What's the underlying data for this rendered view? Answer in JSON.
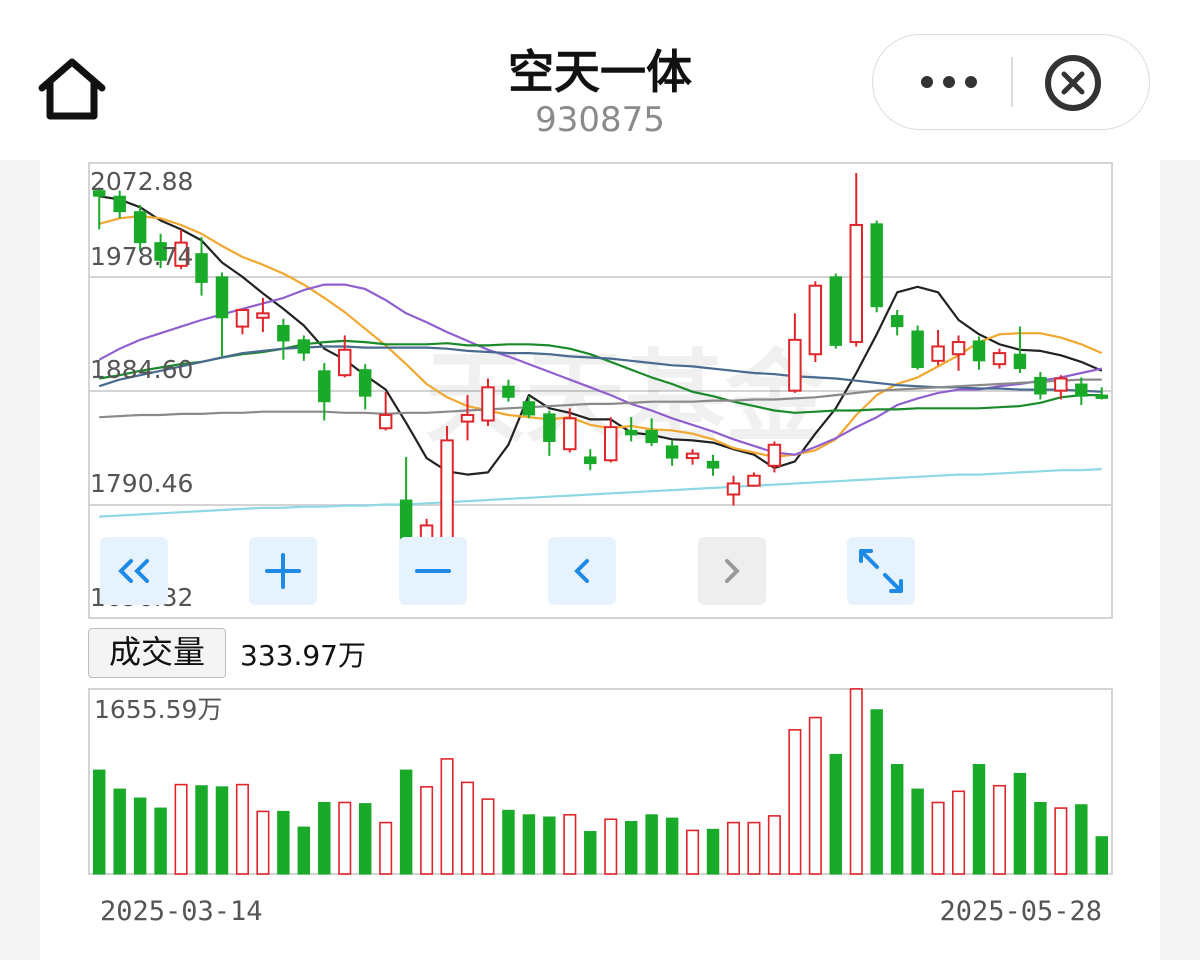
{
  "header": {
    "title": "空天一体",
    "code": "930875"
  },
  "price_axis": {
    "labels": [
      "2072.88",
      "1978.74",
      "1884.60",
      "1790.46",
      "1696.32"
    ]
  },
  "volume": {
    "label": "成交量",
    "current": "333.97万",
    "max_label": "1655.59万"
  },
  "dates": {
    "start": "2025-03-14",
    "end": "2025-05-28"
  },
  "watermark": "天天基金",
  "controls": [
    "first-page",
    "zoom-in",
    "zoom-out",
    "previous",
    "next",
    "fullscreen"
  ],
  "colors": {
    "up": "#e0252b",
    "down": "#1aaa2a",
    "ma5": "#222222",
    "ma10": "#f0a830",
    "ma20": "#9060d0",
    "ma30": "#1a8a2a",
    "ma60": "#4a6a90",
    "ma120": "#8a8a8a",
    "ma250": "#8ed8e6",
    "button_bg": "#e6f2fd",
    "button_icon": "#1e8ae8"
  },
  "chart_data": {
    "type": "candlestick",
    "x_range": [
      "2025-03-14",
      "2025-05-28"
    ],
    "ylim": [
      1696.32,
      2072.88
    ],
    "volume_max": 1655.59,
    "volume_unit": "万",
    "candles": [
      {
        "o": 2065,
        "h": 2068,
        "l": 2030,
        "c": 2060,
        "up": false,
        "vol": 930
      },
      {
        "o": 2060,
        "h": 2065,
        "l": 2040,
        "c": 2046,
        "up": false,
        "vol": 760
      },
      {
        "o": 2046,
        "h": 2052,
        "l": 2010,
        "c": 2018,
        "up": false,
        "vol": 680
      },
      {
        "o": 2018,
        "h": 2026,
        "l": 1995,
        "c": 2002,
        "up": false,
        "vol": 590
      },
      {
        "o": 1997,
        "h": 2030,
        "l": 1994,
        "c": 2018,
        "up": true,
        "vol": 800
      },
      {
        "o": 2008,
        "h": 2023,
        "l": 1970,
        "c": 1982,
        "up": false,
        "vol": 790
      },
      {
        "o": 1987,
        "h": 1991,
        "l": 1915,
        "c": 1950,
        "up": false,
        "vol": 780
      },
      {
        "o": 1942,
        "h": 1957,
        "l": 1935,
        "c": 1957,
        "up": true,
        "vol": 800
      },
      {
        "o": 1950,
        "h": 1968,
        "l": 1937,
        "c": 1954,
        "up": true,
        "vol": 560
      },
      {
        "o": 1943,
        "h": 1949,
        "l": 1912,
        "c": 1929,
        "up": false,
        "vol": 560
      },
      {
        "o": 1930,
        "h": 1934,
        "l": 1911,
        "c": 1918,
        "up": false,
        "vol": 420
      },
      {
        "o": 1902,
        "h": 1909,
        "l": 1857,
        "c": 1874,
        "up": false,
        "vol": 640
      },
      {
        "o": 1898,
        "h": 1934,
        "l": 1896,
        "c": 1921,
        "up": true,
        "vol": 640
      },
      {
        "o": 1903,
        "h": 1908,
        "l": 1867,
        "c": 1879,
        "up": false,
        "vol": 630
      },
      {
        "o": 1850,
        "h": 1883,
        "l": 1848,
        "c": 1862,
        "up": true,
        "vol": 460
      },
      {
        "o": 1785,
        "h": 1824,
        "l": 1706,
        "c": 1720,
        "up": false,
        "vol": 930
      },
      {
        "o": 1733,
        "h": 1768,
        "l": 1731,
        "c": 1762,
        "up": true,
        "vol": 780
      },
      {
        "o": 1737,
        "h": 1852,
        "l": 1736,
        "c": 1839,
        "up": true,
        "vol": 1030
      },
      {
        "o": 1856,
        "h": 1880,
        "l": 1839,
        "c": 1862,
        "up": true,
        "vol": 820
      },
      {
        "o": 1857,
        "h": 1895,
        "l": 1852,
        "c": 1887,
        "up": true,
        "vol": 670
      },
      {
        "o": 1888,
        "h": 1894,
        "l": 1874,
        "c": 1878,
        "up": false,
        "vol": 570
      },
      {
        "o": 1874,
        "h": 1879,
        "l": 1859,
        "c": 1862,
        "up": false,
        "vol": 530
      },
      {
        "o": 1863,
        "h": 1866,
        "l": 1825,
        "c": 1838,
        "up": false,
        "vol": 510
      },
      {
        "o": 1831,
        "h": 1868,
        "l": 1828,
        "c": 1859,
        "up": true,
        "vol": 530
      },
      {
        "o": 1824,
        "h": 1831,
        "l": 1812,
        "c": 1818,
        "up": false,
        "vol": 380
      },
      {
        "o": 1821,
        "h": 1860,
        "l": 1819,
        "c": 1851,
        "up": true,
        "vol": 490
      },
      {
        "o": 1848,
        "h": 1860,
        "l": 1838,
        "c": 1844,
        "up": false,
        "vol": 470
      },
      {
        "o": 1848,
        "h": 1859,
        "l": 1834,
        "c": 1837,
        "up": false,
        "vol": 530
      },
      {
        "o": 1834,
        "h": 1839,
        "l": 1816,
        "c": 1823,
        "up": false,
        "vol": 500
      },
      {
        "o": 1823,
        "h": 1831,
        "l": 1817,
        "c": 1827,
        "up": true,
        "vol": 390
      },
      {
        "o": 1820,
        "h": 1826,
        "l": 1807,
        "c": 1814,
        "up": false,
        "vol": 400
      },
      {
        "o": 1790,
        "h": 1807,
        "l": 1780,
        "c": 1800,
        "up": true,
        "vol": 460
      },
      {
        "o": 1798,
        "h": 1810,
        "l": 1797,
        "c": 1807,
        "up": true,
        "vol": 460
      },
      {
        "o": 1816,
        "h": 1838,
        "l": 1810,
        "c": 1835,
        "up": true,
        "vol": 520
      },
      {
        "o": 1884,
        "h": 1954,
        "l": 1882,
        "c": 1930,
        "up": true,
        "vol": 1290
      },
      {
        "o": 1917,
        "h": 1983,
        "l": 1910,
        "c": 1979,
        "up": true,
        "vol": 1400
      },
      {
        "o": 1925,
        "h": 1990,
        "l": 1922,
        "c": 1987,
        "up": false,
        "vol": 1070
      },
      {
        "o": 1928,
        "h": 2081,
        "l": 1924,
        "c": 2034,
        "up": true,
        "vol": 1656
      },
      {
        "o": 2035,
        "h": 2038,
        "l": 1955,
        "c": 1960,
        "up": false,
        "vol": 1470
      },
      {
        "o": 1952,
        "h": 1957,
        "l": 1934,
        "c": 1942,
        "up": false,
        "vol": 980
      },
      {
        "o": 1938,
        "h": 1943,
        "l": 1903,
        "c": 1905,
        "up": false,
        "vol": 760
      },
      {
        "o": 1911,
        "h": 1939,
        "l": 1907,
        "c": 1924,
        "up": true,
        "vol": 640
      },
      {
        "o": 1917,
        "h": 1934,
        "l": 1902,
        "c": 1928,
        "up": true,
        "vol": 740
      },
      {
        "o": 1929,
        "h": 1933,
        "l": 1903,
        "c": 1911,
        "up": false,
        "vol": 980
      },
      {
        "o": 1908,
        "h": 1922,
        "l": 1904,
        "c": 1918,
        "up": true,
        "vol": 790
      },
      {
        "o": 1917,
        "h": 1942,
        "l": 1900,
        "c": 1904,
        "up": false,
        "vol": 900
      },
      {
        "o": 1896,
        "h": 1901,
        "l": 1876,
        "c": 1881,
        "up": false,
        "vol": 640
      },
      {
        "o": 1884,
        "h": 1898,
        "l": 1876,
        "c": 1895,
        "up": true,
        "vol": 590
      },
      {
        "o": 1890,
        "h": 1896,
        "l": 1871,
        "c": 1879,
        "up": false,
        "vol": 620
      },
      {
        "o": 1880,
        "h": 1887,
        "l": 1876,
        "c": 1877,
        "up": false,
        "vol": 334
      }
    ],
    "moving_averages": [
      {
        "name": "MA5",
        "color": "#222222",
        "values": [
          2060,
          2057,
          2050,
          2038,
          2030,
          2020,
          2000,
          1987,
          1972,
          1958,
          1943,
          1922,
          1912,
          1898,
          1885,
          1855,
          1823,
          1811,
          1808,
          1810,
          1835,
          1880,
          1868,
          1864,
          1858,
          1858,
          1846,
          1844,
          1840,
          1839,
          1837,
          1831,
          1826,
          1814,
          1820,
          1845,
          1868,
          1900,
          1935,
          1973,
          1978,
          1973,
          1948,
          1935,
          1926,
          1921,
          1920,
          1916,
          1910,
          1902
        ]
      },
      {
        "name": "MA10",
        "color": "#f0a830",
        "values": [
          2035,
          2040,
          2042,
          2040,
          2034,
          2026,
          2015,
          2005,
          1998,
          1990,
          1980,
          1968,
          1955,
          1940,
          1925,
          1908,
          1890,
          1878,
          1870,
          1866,
          1862,
          1860,
          1858,
          1860,
          1853,
          1850,
          1852,
          1849,
          1848,
          1845,
          1840,
          1832,
          1828,
          1824,
          1826,
          1830,
          1840,
          1862,
          1880,
          1890,
          1896,
          1906,
          1916,
          1928,
          1935,
          1936,
          1936,
          1932,
          1926,
          1918
        ]
      },
      {
        "name": "MA20",
        "color": "#9060d0",
        "values": [
          1912,
          1922,
          1930,
          1936,
          1942,
          1948,
          1953,
          1958,
          1963,
          1968,
          1975,
          1980,
          1980,
          1976,
          1966,
          1954,
          1946,
          1937,
          1929,
          1921,
          1915,
          1908,
          1901,
          1894,
          1887,
          1880,
          1872,
          1866,
          1859,
          1853,
          1847,
          1840,
          1834,
          1828,
          1826,
          1833,
          1841,
          1851,
          1860,
          1871,
          1877,
          1882,
          1885,
          1885,
          1888,
          1890,
          1893,
          1896,
          1900,
          1904
        ]
      },
      {
        "name": "MA30",
        "color": "#1a8a2a",
        "values": [
          1895,
          1898,
          1902,
          1905,
          1908,
          1910,
          1914,
          1917,
          1919,
          1922,
          1926,
          1928,
          1929,
          1928,
          1926,
          1926,
          1926,
          1927,
          1925,
          1925,
          1926,
          1926,
          1925,
          1922,
          1917,
          1910,
          1903,
          1896,
          1890,
          1883,
          1879,
          1874,
          1870,
          1866,
          1864,
          1865,
          1866,
          1866,
          1867,
          1867,
          1868,
          1868,
          1868,
          1868,
          1869,
          1870,
          1873,
          1878,
          1880,
          1880
        ]
      },
      {
        "name": "MA60",
        "color": "#4a6a90",
        "values": [
          1888,
          1894,
          1898,
          1902,
          1906,
          1910,
          1914,
          1918,
          1920,
          1922,
          1923,
          1924,
          1924,
          1923,
          1923,
          1923,
          1923,
          1922,
          1920,
          1919,
          1918,
          1918,
          1917,
          1915,
          1914,
          1913,
          1911,
          1909,
          1907,
          1906,
          1904,
          1902,
          1900,
          1899,
          1897,
          1896,
          1895,
          1893,
          1891,
          1889,
          1888,
          1887,
          1887,
          1886,
          1886,
          1885,
          1885,
          1885,
          1884,
          1883
        ]
      },
      {
        "name": "MA120",
        "color": "#8a8a8a",
        "values": [
          1860,
          1861,
          1862,
          1862,
          1863,
          1863,
          1864,
          1864,
          1865,
          1865,
          1865,
          1865,
          1864,
          1864,
          1863,
          1864,
          1864,
          1865,
          1866,
          1867,
          1868,
          1869,
          1870,
          1871,
          1872,
          1872,
          1873,
          1874,
          1874,
          1874,
          1875,
          1875,
          1876,
          1876,
          1877,
          1878,
          1880,
          1882,
          1884,
          1885,
          1886,
          1887,
          1888,
          1889,
          1890,
          1891,
          1892,
          1893,
          1894,
          1894
        ]
      },
      {
        "name": "MA250",
        "color": "#8ed8e6",
        "values": [
          1770,
          1771,
          1772,
          1773,
          1774,
          1775,
          1776,
          1777,
          1778,
          1778,
          1779,
          1779,
          1780,
          1780,
          1781,
          1781,
          1782,
          1783,
          1784,
          1785,
          1786,
          1787,
          1788,
          1789,
          1790,
          1791,
          1792,
          1793,
          1794,
          1795,
          1796,
          1797,
          1798,
          1799,
          1800,
          1801,
          1802,
          1803,
          1804,
          1805,
          1806,
          1807,
          1808,
          1808,
          1809,
          1810,
          1811,
          1812,
          1812,
          1813
        ]
      }
    ]
  }
}
